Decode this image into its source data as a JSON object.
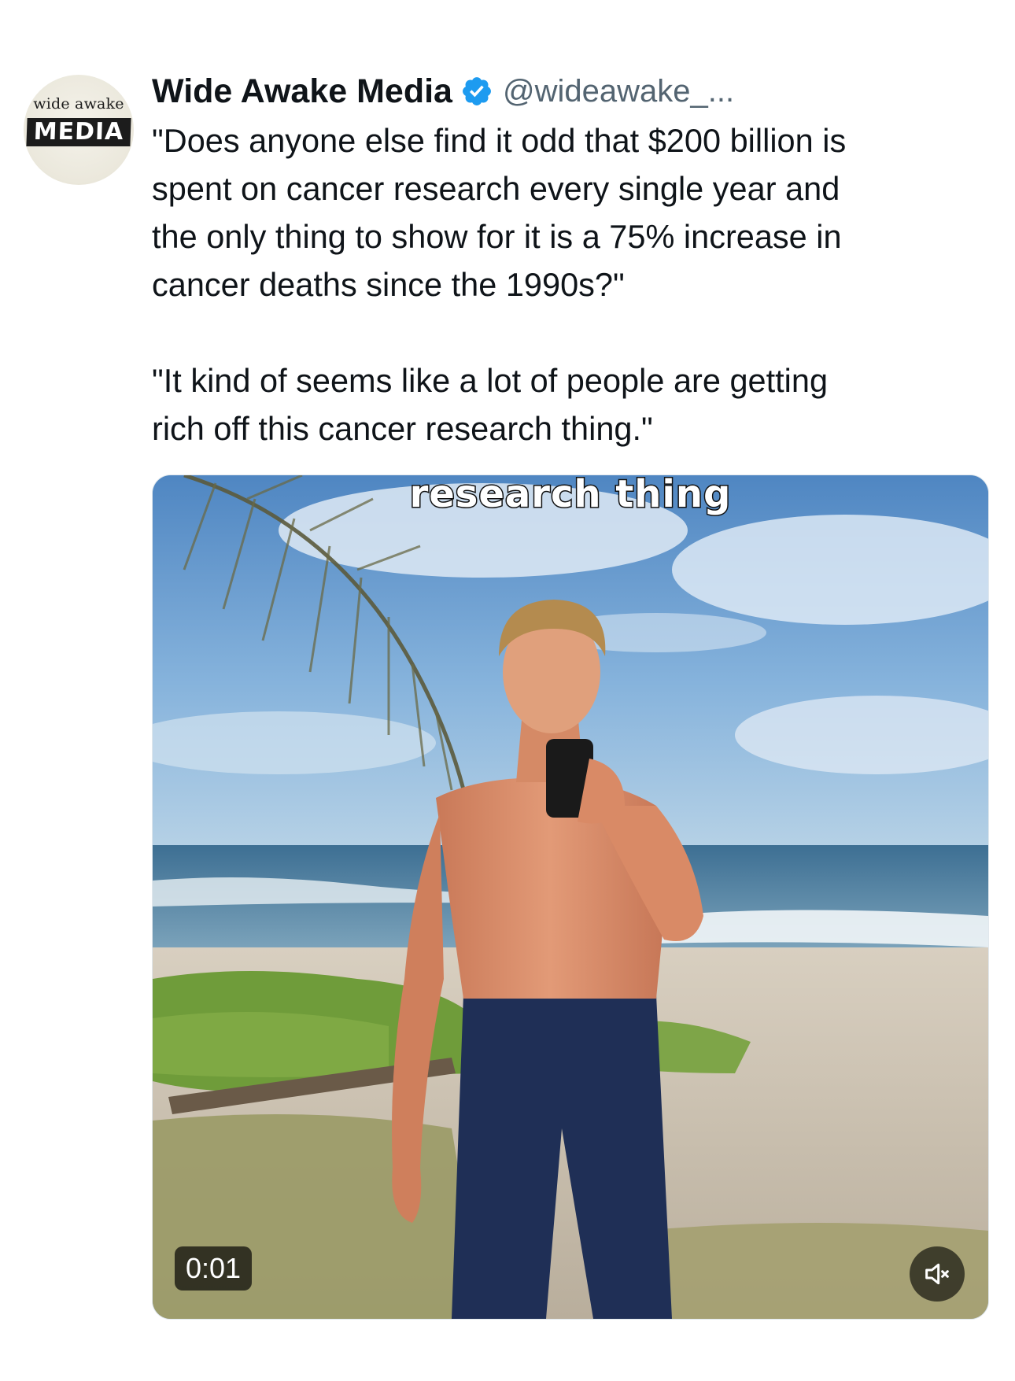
{
  "author": {
    "name": "Wide Awake Media",
    "handle": "@wideawake_...",
    "verified": true,
    "avatar_logo_line1": "wide awake",
    "avatar_logo_line2": "MEDIA"
  },
  "tweet": {
    "paragraphs": [
      "\"Does anyone else find it odd that $200 billion is\nspent on cancer research every single year and\nthe only thing to show for it is a 75% increase in\ncancer deaths since the 1990s?\"",
      "\"It kind of seems like a lot of people are getting\nrich off this cancer research thing.\""
    ]
  },
  "video": {
    "caption": "research thing",
    "timestamp": "0:01",
    "muted": true
  },
  "colors": {
    "text_primary": "#0f1419",
    "text_secondary": "#536471",
    "verified_blue": "#1d9bf0"
  },
  "icons": {
    "verified": "verified-badge-icon",
    "mute": "volume-muted-icon"
  }
}
